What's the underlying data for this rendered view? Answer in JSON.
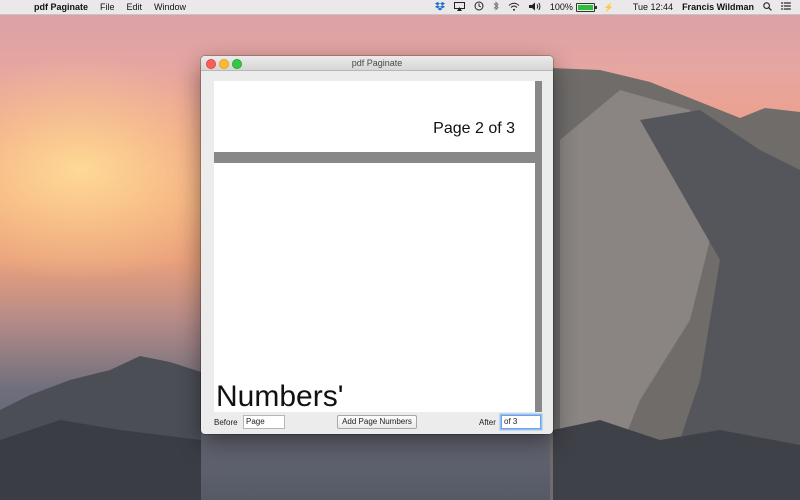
{
  "menubar": {
    "app_name": "pdf Paginate",
    "menus": [
      "File",
      "Edit",
      "Window"
    ],
    "battery_percent": "100%",
    "battery_level": 1.0,
    "clock": "Tue 12:44",
    "user": "Francis Wildman"
  },
  "window": {
    "title": "pdf Paginate",
    "page1_text": "Page 2 of 3",
    "page2_text": "e Numbers'",
    "before_label": "Before",
    "before_value": "Page",
    "add_button": "Add Page Numbers",
    "after_label": "After",
    "after_value": "of 3"
  },
  "colors": {
    "close": "#fc5f57",
    "minimize": "#fdbc2e",
    "zoom": "#34c84a",
    "focus_ring": "#6aa2e8",
    "battery": "#2ebf3a"
  }
}
